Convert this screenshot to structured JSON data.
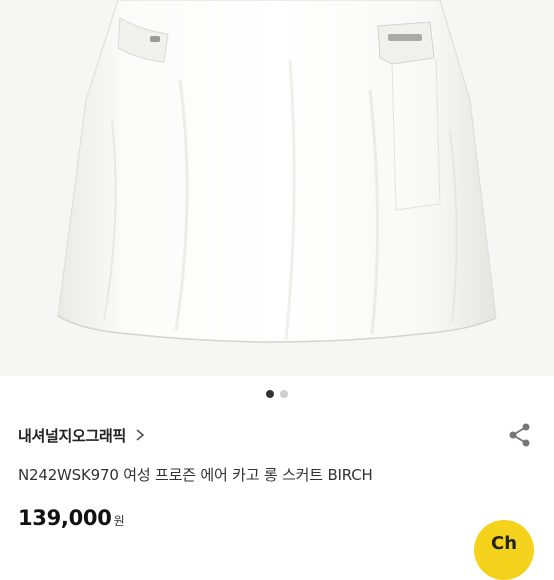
{
  "product": {
    "brand": "내셔널지오그래픽",
    "title": "N242WSK970 여성 프로즌 에어 카고 롱 스커트 BIRCH",
    "price": "139,000",
    "currency": "원"
  },
  "gallery": {
    "total": 2,
    "current": 1
  },
  "badge": {
    "label": "Ch",
    "color": "#f5d21b"
  },
  "icons": {
    "brand_chevron": "chevron-right-icon",
    "share": "share-icon"
  }
}
